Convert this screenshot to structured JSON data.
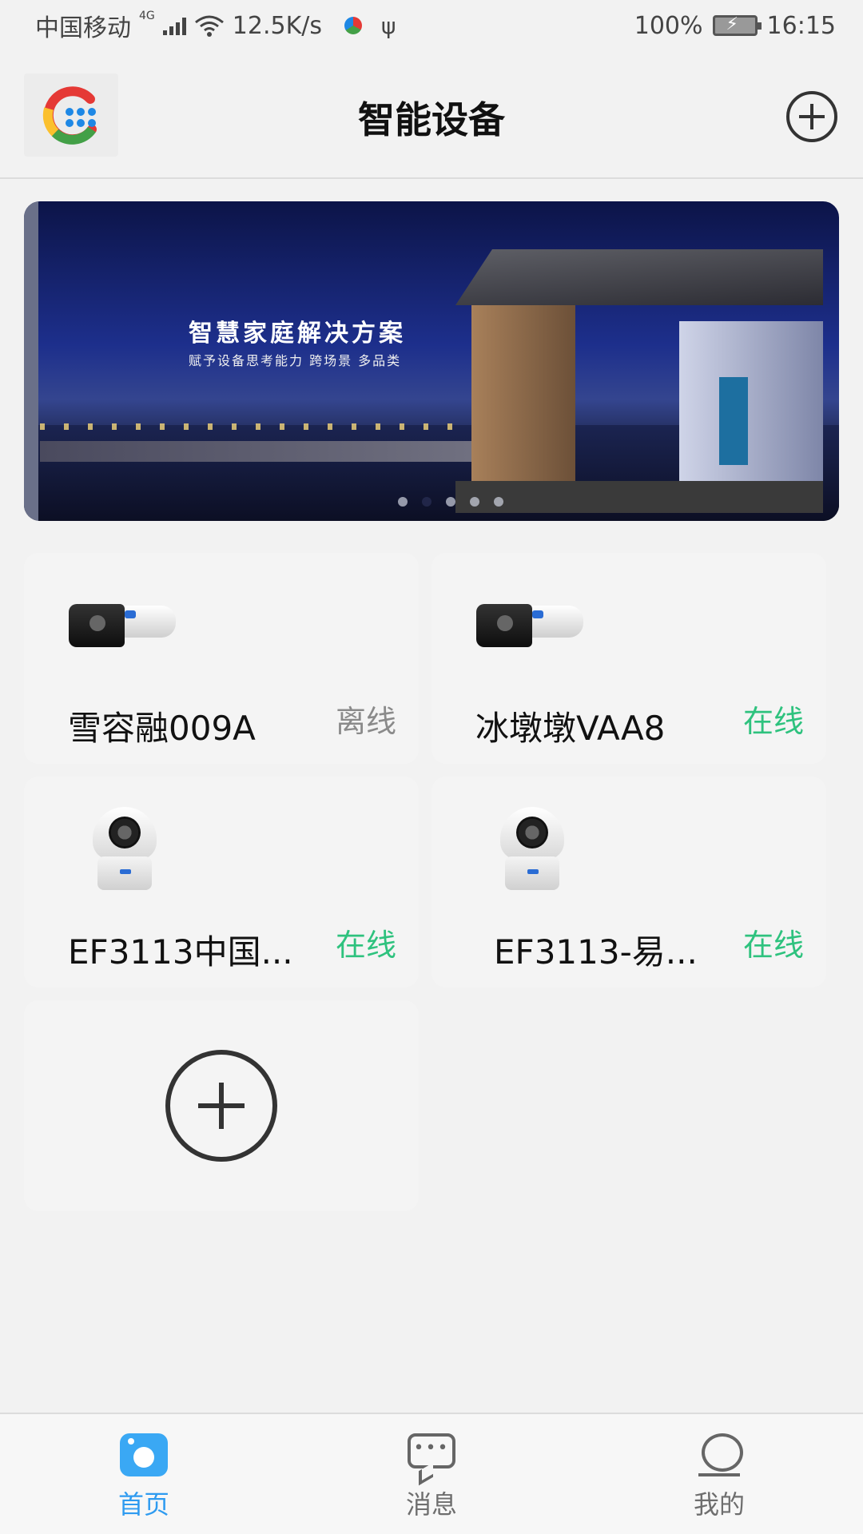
{
  "status_bar": {
    "carrier": "中国移动",
    "network": "4G",
    "speed": "12.5K/s",
    "battery": "100%",
    "time": "16:15"
  },
  "header": {
    "title": "智能设备"
  },
  "banner": {
    "title": "智慧家庭解决方案",
    "subtitle": "赋予设备思考能力 跨场景 多品类",
    "slide_count": 5,
    "active_slide": 2
  },
  "devices": [
    {
      "name": "雪容融009A",
      "status": "离线",
      "type": "bullet-camera",
      "online": false
    },
    {
      "name": "冰墩墩VAA8",
      "status": "在线",
      "type": "bullet-camera",
      "online": true
    },
    {
      "name": "EF3113中国...",
      "status": "在线",
      "type": "dome-camera",
      "online": true
    },
    {
      "name": "EF3113-易...",
      "status": "在线",
      "type": "dome-camera",
      "online": true
    }
  ],
  "tabs": [
    {
      "label": "首页",
      "icon": "home-icon",
      "active": true
    },
    {
      "label": "消息",
      "icon": "message-icon",
      "active": false
    },
    {
      "label": "我的",
      "icon": "profile-icon",
      "active": false
    }
  ],
  "colors": {
    "online": "#2ec27e",
    "offline": "#8a8a8a",
    "accent": "#2e9bf0"
  }
}
